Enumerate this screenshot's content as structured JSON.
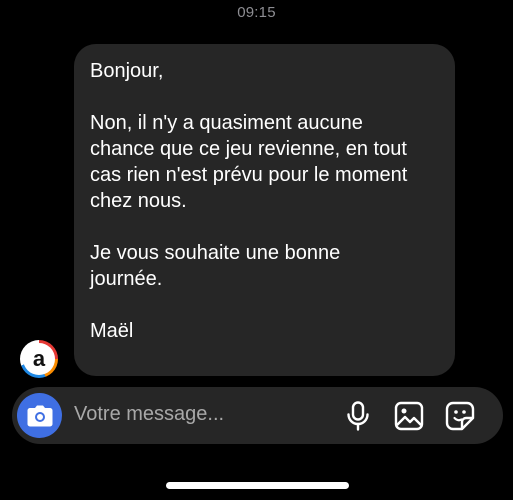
{
  "status": {
    "time": "09:15"
  },
  "message": {
    "lines": [
      "Bonjour,",
      "",
      "Non, il n'y a quasiment aucune",
      "chance que ce jeu revienne, en tout",
      "cas rien n'est prévu pour le moment",
      "chez nous.",
      "",
      "Je vous souhaite une bonne",
      "journée.",
      "",
      "Maël"
    ]
  },
  "avatar": {
    "letter": "a"
  },
  "composer": {
    "placeholder": "Votre message...",
    "icons": [
      "camera-icon",
      "microphone-icon",
      "image-icon",
      "sticker-icon"
    ]
  },
  "colors": {
    "background": "#000000",
    "bubble": "#262626",
    "accent": "#3f6fe3",
    "timestamp": "#8e8e93"
  }
}
